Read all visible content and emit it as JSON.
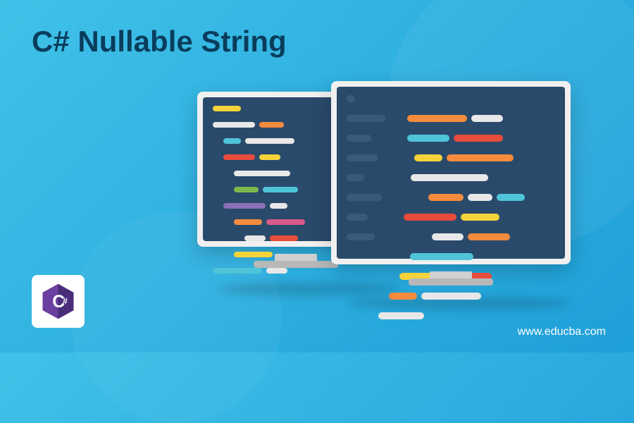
{
  "title": "C# Nullable String",
  "url": "www.educba.com",
  "logo_letter": "C",
  "logo_symbol": "#"
}
